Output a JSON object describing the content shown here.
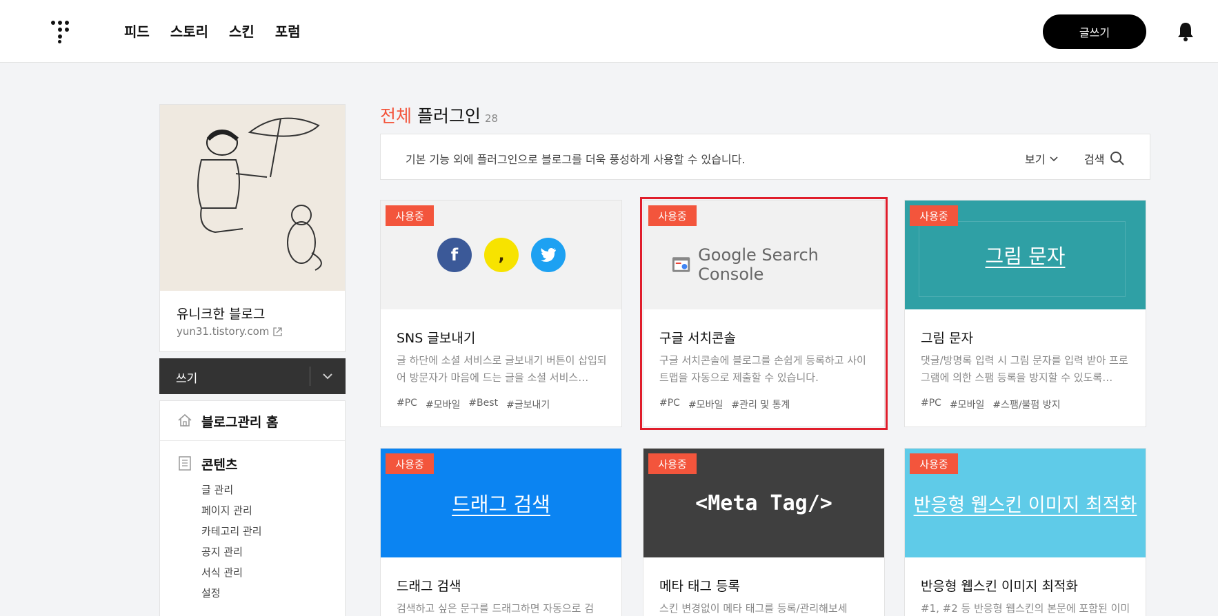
{
  "header": {
    "nav": [
      "피드",
      "스토리",
      "스킨",
      "포럼"
    ],
    "write_button": "글쓰기"
  },
  "sidebar": {
    "blog_name": "유니크한 블로그",
    "blog_url": "yun31.tistory.com",
    "write_label": "쓰기",
    "home_label": "블로그관리 홈",
    "content_label": "콘텐츠",
    "content_items": [
      "글 관리",
      "페이지 관리",
      "카테고리 관리",
      "공지 관리",
      "서식 관리",
      "설정"
    ]
  },
  "main": {
    "heading_accent": "전체",
    "heading_text": "플러그인",
    "heading_count": "28",
    "description": "기본 기능 외에 플러그인으로 블로그를 더욱 풍성하게 사용할 수 있습니다.",
    "view_label": "보기",
    "search_label": "검색"
  },
  "colors": {
    "accent": "#f3553c",
    "selection": "#e01d2b",
    "teal": "#2fa0a5",
    "blue": "#0b84f2",
    "dark": "#3f3f3f",
    "lightblue": "#5fcbe8"
  },
  "cards": [
    {
      "badge": "사용중",
      "title": "SNS 글보내기",
      "desc": "글 하단에 소셜 서비스로 글보내기 버튼이 삽입되어 방문자가 마음에 드는 글을 소셜 서비스…",
      "tags": [
        "#PC",
        "#모바일",
        "#Best",
        "#글보내기"
      ]
    },
    {
      "badge": "사용중",
      "thumb_text": "Google Search Console",
      "title": "구글 서치콘솔",
      "desc": "구글 서치콘솔에 블로그를 손쉽게 등록하고 사이트맵을 자동으로 제출할 수 있습니다.",
      "tags": [
        "#PC",
        "#모바일",
        "#관리 및 통계"
      ]
    },
    {
      "badge": "사용중",
      "thumb_text": "그림 문자",
      "title": "그림 문자",
      "desc": "댓글/방명록 입력 시 그림 문자를 입력 받아 프로그램에 의한 스팸 등록을 방지할 수 있도록…",
      "tags": [
        "#PC",
        "#모바일",
        "#스팸/불펌 방지"
      ]
    },
    {
      "badge": "사용중",
      "thumb_text": "드래그 검색",
      "title": "드래그 검색",
      "desc": "검색하고 싶은 문구를 드래그하면 자동으로 검"
    },
    {
      "badge": "사용중",
      "thumb_text": "<Meta Tag/>",
      "title": "메타 태그 등록",
      "desc": "스킨 변경없이 메타 태그를 등록/관리해보세"
    },
    {
      "badge": "사용중",
      "thumb_text": "반응형 웹스킨 이미지 최적화",
      "title": "반응형 웹스킨 이미지 최적화",
      "desc": "#1, #2 등 반응형 웹스킨의 본문에 포함된 이미"
    }
  ]
}
